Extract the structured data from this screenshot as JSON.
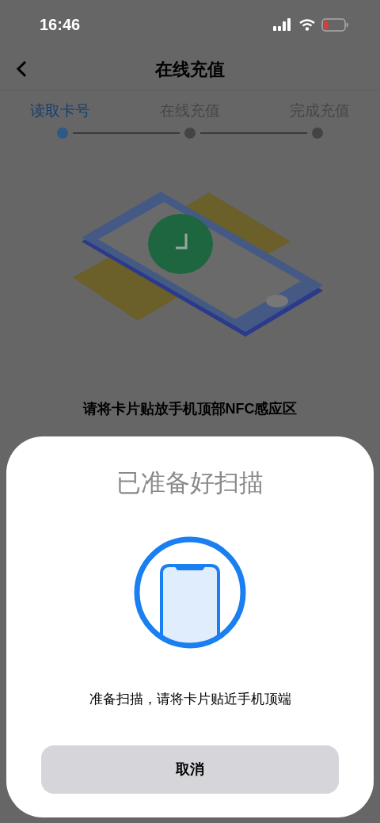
{
  "status_bar": {
    "time": "16:46"
  },
  "nav": {
    "title": "在线充值"
  },
  "steps": [
    {
      "label": "读取卡号",
      "selected": true
    },
    {
      "label": "在线充值",
      "selected": false
    },
    {
      "label": "完成充值",
      "selected": false
    }
  ],
  "instruction": "请将卡片贴放手机顶部NFC感应区",
  "scan_sheet": {
    "title": "已准备好扫描",
    "message": "准备扫描，请将卡片贴近手机顶端",
    "cancel": "取消"
  }
}
